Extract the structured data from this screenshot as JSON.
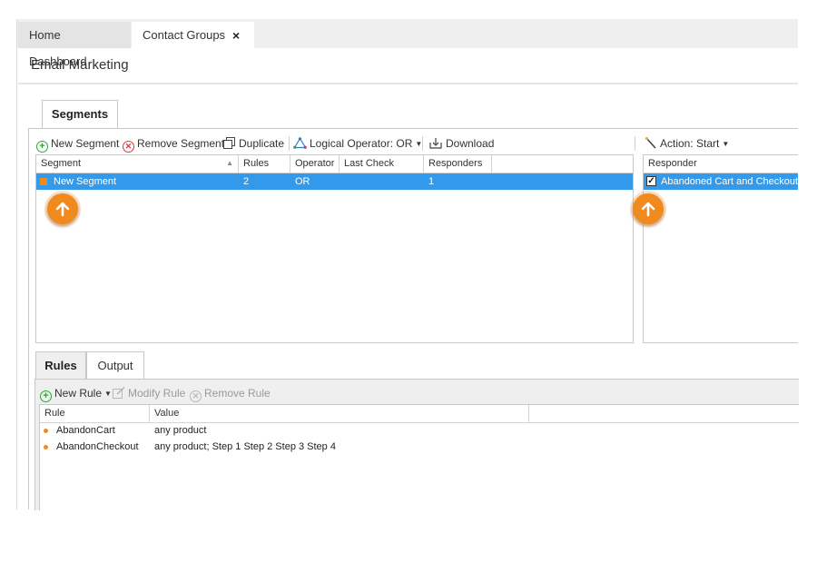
{
  "tabs": [
    {
      "label": "Home Dashboard",
      "active": false
    },
    {
      "label": "Contact Groups",
      "active": true,
      "close": "×"
    }
  ],
  "page_title": "Email Marketing",
  "segments_tab": "Segments",
  "toolbar": {
    "new_segment": "New Segment",
    "remove_segment": "Remove Segment",
    "duplicate": "Duplicate",
    "logical_operator": "Logical Operator: OR",
    "download": "Download",
    "action": "Action: Start"
  },
  "segments_grid": {
    "columns": [
      "Segment",
      "Rules",
      "Operator",
      "Last Check",
      "Responders"
    ],
    "rows": [
      {
        "segment": "New Segment",
        "rules": "2",
        "operator": "OR",
        "last_check": "",
        "responders": "1",
        "selected": true
      }
    ]
  },
  "responder_grid": {
    "columns": [
      "Responder"
    ],
    "rows": [
      {
        "responder": "Abandoned Cart and Checkout",
        "checked": true,
        "selected": true
      }
    ]
  },
  "bottom_tabs": [
    {
      "label": "Rules",
      "active": true
    },
    {
      "label": "Output",
      "active": false
    }
  ],
  "rules_toolbar": {
    "new_rule": "New Rule",
    "modify_rule": "Modify Rule",
    "remove_rule": "Remove Rule"
  },
  "rules_grid": {
    "columns": [
      "Rule",
      "Value"
    ],
    "rows": [
      {
        "rule": "AbandonCart",
        "value": "any product"
      },
      {
        "rule": "AbandonCheckout",
        "value": "any product; Step 1 Step 2 Step 3 Step 4"
      }
    ]
  },
  "colors": {
    "selection": "#3399ea",
    "pointer": "#f08a1c",
    "add": "#2ea43a",
    "remove": "#e0363a"
  }
}
